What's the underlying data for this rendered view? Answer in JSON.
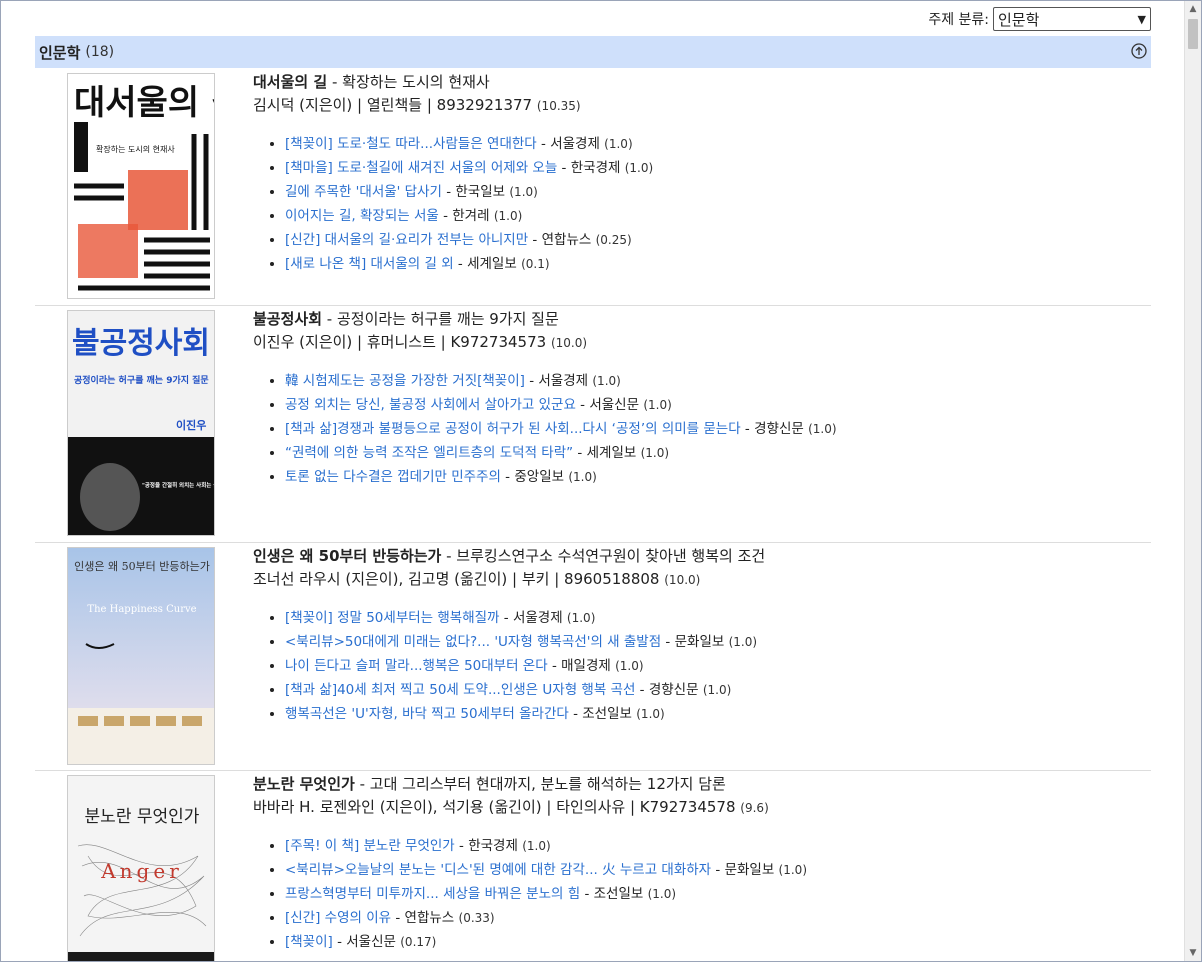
{
  "filter": {
    "label": "주제 분류:",
    "selected": "인문학"
  },
  "section": {
    "title": "인문학",
    "count": "(18)"
  },
  "books": [
    {
      "title": "대서울의 길",
      "subtitle": " - 확장하는 도시의 현재사",
      "authors": "김시덕 (지은이) | 열린책들 | 8932921377",
      "score": "(10.35)",
      "cover": {
        "title_text": "대서울의 길",
        "subtitle_text": "확장하는 도시의 현재사",
        "bg": "#ffffff",
        "accent": "#e8583a"
      },
      "reviews": [
        {
          "text": "[책꽂이] 도로·철도 따라...사람들은 연대한다",
          "source": "서울경제",
          "weight": "(1.0)"
        },
        {
          "text": "[책마을] 도로·철길에 새겨진 서울의 어제와 오늘",
          "source": "한국경제",
          "weight": "(1.0)"
        },
        {
          "text": "길에 주목한 '대서울' 답사기",
          "source": "한국일보",
          "weight": "(1.0)"
        },
        {
          "text": "이어지는 길, 확장되는 서울",
          "source": "한겨레",
          "weight": "(1.0)"
        },
        {
          "text": "[신간] 대서울의 길·요리가 전부는 아니지만",
          "source": "연합뉴스",
          "weight": "(0.25)"
        },
        {
          "text": "[새로 나온 책] 대서울의 길 외",
          "source": "세계일보",
          "weight": "(0.1)"
        }
      ]
    },
    {
      "title": "불공정사회",
      "subtitle": " - 공정이라는 허구를 깨는 9가지 질문",
      "authors": "이진우 (지은이) | 휴머니스트 | K972734573",
      "score": "(10.0)",
      "cover": {
        "title_text": "불공정사회",
        "subtitle_text": "공정이라는 허구를 깨는 9가지 질문",
        "author_text": "이진우",
        "quote_text": "\"공정을 간절히 외치는 사회는 불공정사회다!\"",
        "bg": "#f2f2f2",
        "accent": "#1f4fc4"
      },
      "reviews": [
        {
          "text": "韓 시험제도는 공정을 가장한 거짓[책꽂이]",
          "source": "서울경제",
          "weight": "(1.0)"
        },
        {
          "text": "공정 외치는 당신, 불공정 사회에서 살아가고 있군요",
          "source": "서울신문",
          "weight": "(1.0)"
        },
        {
          "text": "[책과 삶]경쟁과 불평등으로 공정이 허구가 된 사회...다시 ‘공정’의 의미를 묻는다",
          "source": "경향신문",
          "weight": "(1.0)"
        },
        {
          "text": "“권력에 의한 능력 조작은 엘리트층의 도덕적 타락”",
          "source": "세계일보",
          "weight": "(1.0)"
        },
        {
          "text": "토론 없는 다수결은 껍데기만 민주주의",
          "source": "중앙일보",
          "weight": "(1.0)"
        }
      ]
    },
    {
      "title": "인생은 왜 50부터 반등하는가",
      "subtitle": " - 브루킹스연구소 수석연구원이 찾아낸 행복의 조건",
      "authors": "조너선 라우시 (지은이), 김고명 (옮긴이) | 부키 | 8960518808",
      "score": "(10.0)",
      "cover": {
        "title_text": "인생은 왜 50부터 반등하는가",
        "subtitle_text": "The Happiness Curve",
        "bg": "#dfe7f2",
        "accent": "#5a6f95"
      },
      "reviews": [
        {
          "text": "[책꽂이] 정말 50세부터는 행복해질까",
          "source": "서울경제",
          "weight": "(1.0)"
        },
        {
          "text": "<북리뷰>50대에게 미래는 없다?... 'U자형 행복곡선'의 새 출발점",
          "source": "문화일보",
          "weight": "(1.0)"
        },
        {
          "text": "나이 든다고 슬퍼 말라...행복은 50대부터 온다",
          "source": "매일경제",
          "weight": "(1.0)"
        },
        {
          "text": "[책과 삶]40세 최저 찍고 50세 도약...인생은 U자형 행복 곡선",
          "source": "경향신문",
          "weight": "(1.0)"
        },
        {
          "text": "행복곡선은 'U'자형, 바닥 찍고 50세부터 올라간다",
          "source": "조선일보",
          "weight": "(1.0)"
        }
      ]
    },
    {
      "title": "분노란 무엇인가",
      "subtitle": " - 고대 그리스부터 현대까지, 분노를 해석하는 12가지 담론",
      "authors": "바바라 H. 로젠와인 (지은이), 석기용 (옮긴이) | 타인의사유 | K792734578",
      "score": "(9.6)",
      "cover": {
        "title_text": "분노란 무엇인가",
        "subtitle_text": "Anger",
        "bg": "#f4f4f4",
        "accent": "#c23a2e"
      },
      "reviews": [
        {
          "text": "[주목! 이 책] 분노란 무엇인가",
          "source": "한국경제",
          "weight": "(1.0)"
        },
        {
          "text": "<북리뷰>오늘날의 분노는 '디스'된 명예에 대한 감각... 火 누르고 대화하자",
          "source": "문화일보",
          "weight": "(1.0)"
        },
        {
          "text": "프랑스혁명부터 미투까지... 세상을 바꿔은 분노의 힘",
          "source": "조선일보",
          "weight": "(1.0)"
        },
        {
          "text": "[신간] 수영의 이유",
          "source": "연합뉴스",
          "weight": "(0.33)"
        },
        {
          "text": "[책꽂이]",
          "source": "서울신문",
          "weight": "(0.17)"
        }
      ]
    }
  ]
}
